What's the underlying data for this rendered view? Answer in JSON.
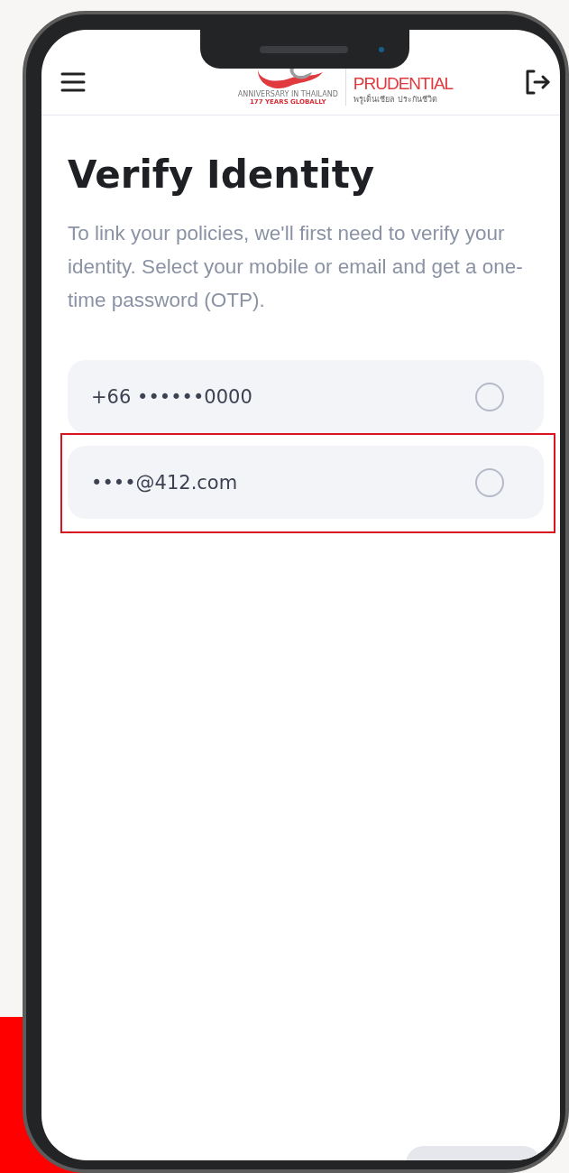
{
  "header": {
    "logo": {
      "anniversary_line": "ANNIVERSARY IN THAILAND",
      "globally_line": "177 YEARS GLOBALLY",
      "brand": "PRUDENTIAL",
      "brand_thai": "พรูเด็นเชียล ประกันชีวิต"
    }
  },
  "title": "Verify Identity",
  "description": "To link your policies, we'll first need to verify your identity. Select your mobile or email and get a one-time password (OTP).",
  "options": [
    {
      "label": "+66 ••••••0000",
      "selected": false,
      "highlighted": false
    },
    {
      "label": "••••@412.com",
      "selected": false,
      "highlighted": true
    }
  ]
}
